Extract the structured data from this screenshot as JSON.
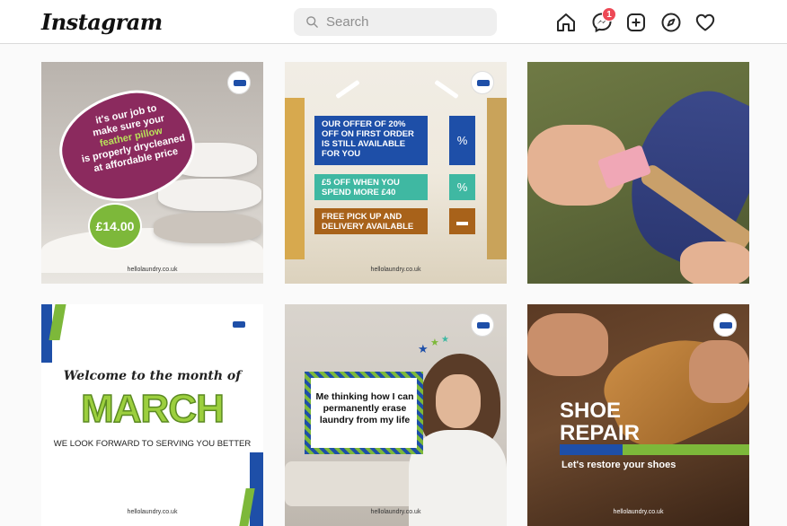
{
  "header": {
    "logo": "Instagram",
    "search_placeholder": "Search",
    "messages_badge": "1",
    "nav_icons": [
      "home-icon",
      "messenger-icon",
      "new-post-icon",
      "explore-icon",
      "activity-heart-icon"
    ]
  },
  "posts": [
    {
      "caption": [
        "it's our job to",
        "make sure your",
        "feather pillow",
        "is properly drycleaned",
        "at affordable price"
      ],
      "price": "£14.00",
      "url": "hellolaundry.co.uk"
    },
    {
      "offers": [
        "OUR OFFER OF 20% OFF ON FIRST ORDER IS STILL AVAILABLE FOR YOU",
        "£5 OFF WHEN YOU SPEND MORE £40",
        "FREE PICK UP AND DELIVERY AVAILABLE"
      ],
      "url": "hellolaundry.co.uk"
    },
    {
      "description": "shoe cleaning photo"
    },
    {
      "welcome": "Welcome to the month of",
      "month": "MARCH",
      "subtitle": "WE LOOK FORWARD TO SERVING YOU BETTER",
      "url": "hellolaundry.co.uk"
    },
    {
      "quote": "Me thinking how I can permanently erase laundry from my life",
      "url": "hellolaundry.co.uk"
    },
    {
      "headline": "SHOE REPAIR",
      "tagline": "Let's restore your shoes",
      "url": "hellolaundry.co.uk"
    }
  ],
  "colors": {
    "brand_blue": "#1e4fa8",
    "brand_green": "#7db83a",
    "magenta": "#8b2a5e",
    "badge_red": "#ed4956"
  }
}
